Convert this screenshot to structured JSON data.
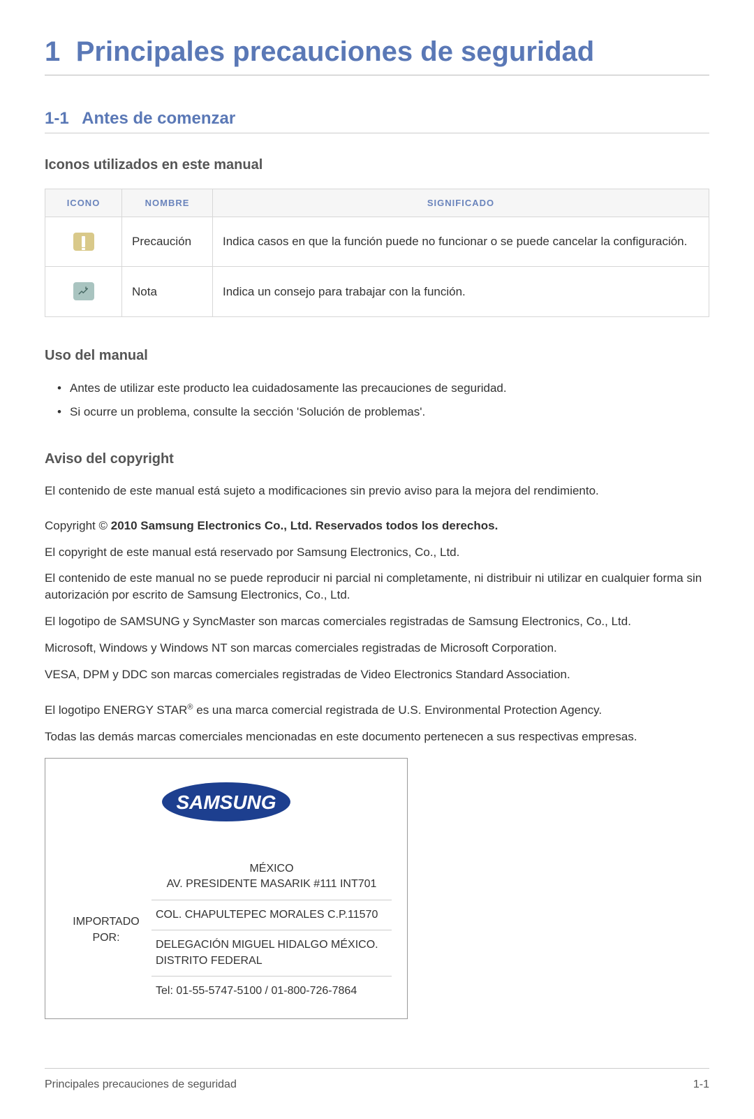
{
  "chapter": {
    "number": "1",
    "title": "Principales precauciones de seguridad"
  },
  "section": {
    "number": "1-1",
    "title": "Antes de comenzar"
  },
  "icons_section": {
    "heading": "Iconos utilizados en este manual",
    "headers": {
      "icon": "ICONO",
      "name": "NOMBRE",
      "meaning": "SIGNIFICADO"
    },
    "rows": [
      {
        "icon": "caution",
        "name": "Precaución",
        "meaning": "Indica casos en que la función puede no funcionar o se puede cancelar la configuración."
      },
      {
        "icon": "note",
        "name": "Nota",
        "meaning": "Indica un consejo para trabajar con la función."
      }
    ]
  },
  "usage_section": {
    "heading": "Uso del manual",
    "bullets": [
      "Antes de utilizar este producto lea cuidadosamente las precauciones de seguridad.",
      "Si ocurre un problema, consulte la sección 'Solución de problemas'."
    ]
  },
  "copyright_section": {
    "heading": "Aviso del copyright",
    "p1": "El contenido de este manual está sujeto a modificaciones sin previo aviso para la mejora del rendimiento.",
    "copy_prefix": "Copyright © ",
    "copy_bold": "2010 Samsung Electronics Co., Ltd. Reservados todos los derechos.",
    "p2": "El copyright de este manual está reservado por Samsung Electronics, Co., Ltd.",
    "p3": "El contenido de este manual no se puede reproducir ni parcial ni completamente, ni distribuir ni utilizar en cualquier forma sin autorización por escrito de Samsung Electronics, Co., Ltd.",
    "p4": "El logotipo de SAMSUNG y SyncMaster son marcas comerciales registradas de Samsung Electronics, Co., Ltd.",
    "p5": "Microsoft, Windows y Windows NT son marcas comerciales registradas de Microsoft Corporation.",
    "p6": "VESA, DPM y DDC son marcas comerciales registradas de Video Electronics Standard Association.",
    "energy_pre": "El logotipo ENERGY STAR",
    "energy_sup": "®",
    "energy_post": " es una marca comercial registrada de U.S. Environmental Protection Agency.",
    "p8": "Todas las demás marcas comerciales mencionadas en este documento pertenecen a sus respectivas empresas."
  },
  "importer": {
    "label": "IMPORTADO POR:",
    "country": "MÉXICO",
    "addr1": "AV. PRESIDENTE MASARIK #111 INT701",
    "addr2": "COL. CHAPULTEPEC MORALES C.P.11570",
    "addr3": "DELEGACIÓN MIGUEL HIDALGO MÉXICO. DISTRITO FEDERAL",
    "tel": "Tel: 01-55-5747-5100 / 01-800-726-7864"
  },
  "footer": {
    "left": "Principales precauciones de seguridad",
    "right": "1-1"
  },
  "logo_text": "SAMSUNG"
}
